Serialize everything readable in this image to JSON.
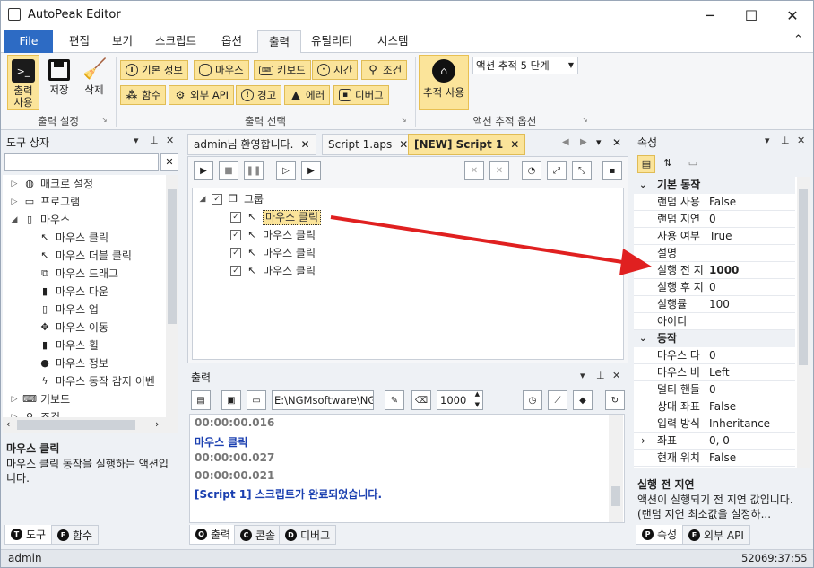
{
  "window": {
    "title": "AutoPeak Editor",
    "minimize": "─",
    "maximize": "☐",
    "close": "✕"
  },
  "menu": {
    "tabs": [
      "File",
      "편집",
      "보기",
      "스크립트",
      "옵션",
      "출력",
      "유틸리티",
      "시스템"
    ],
    "active": "출력",
    "collapse": "⌃"
  },
  "ribbon": {
    "output_settings": {
      "group_label": "출력 설정",
      "buttons": [
        {
          "label": "출력\n사용",
          "l1": "출력",
          "l2": "사용"
        },
        {
          "label": "저장"
        },
        {
          "label": "삭제"
        }
      ]
    },
    "output_select": {
      "group_label": "출력 선택",
      "row1": [
        "기본 정보",
        "마우스",
        "키보드",
        "시간",
        "조건"
      ],
      "row2": [
        "함수",
        "외부 API",
        "경고",
        "에러",
        "디버그"
      ]
    },
    "action_trace": {
      "group_label": "액션 추적 옵션",
      "button": "추적 사용",
      "select_value": "액션 추적 5 단계"
    }
  },
  "toolbox": {
    "title": "도구 상자",
    "search_placeholder": "",
    "items": [
      {
        "label": "매크로 설정",
        "level": 0,
        "expand": "▷",
        "icon": "globe-icon",
        "glyph": "◍"
      },
      {
        "label": "프로그램",
        "level": 0,
        "expand": "▷",
        "icon": "program-icon",
        "glyph": "▭"
      },
      {
        "label": "마우스",
        "level": 0,
        "expand": "◢",
        "icon": "mouse-icon",
        "glyph": "▯"
      },
      {
        "label": "마우스 클릭",
        "level": 1,
        "icon": "mouse-click-icon",
        "glyph": "↖"
      },
      {
        "label": "마우스 더블 클릭",
        "level": 1,
        "icon": "mouse-double-click-icon",
        "glyph": "↖"
      },
      {
        "label": "마우스 드래그",
        "level": 1,
        "icon": "mouse-drag-icon",
        "glyph": "⧉"
      },
      {
        "label": "마우스 다운",
        "level": 1,
        "icon": "mouse-down-icon",
        "glyph": "▮"
      },
      {
        "label": "마우스 업",
        "level": 1,
        "icon": "mouse-up-icon",
        "glyph": "▯"
      },
      {
        "label": "마우스 이동",
        "level": 1,
        "icon": "mouse-move-icon",
        "glyph": "✥"
      },
      {
        "label": "마우스 휠",
        "level": 1,
        "icon": "mouse-wheel-icon",
        "glyph": "▮"
      },
      {
        "label": "마우스 정보",
        "level": 1,
        "icon": "mouse-info-icon",
        "glyph": "●"
      },
      {
        "label": "마우스 동작 감지 이벤",
        "level": 1,
        "icon": "lightning-icon",
        "glyph": "ϟ"
      },
      {
        "label": "키보드",
        "level": 0,
        "expand": "▷",
        "icon": "keyboard-icon",
        "glyph": "⌨"
      },
      {
        "label": "조건",
        "level": 0,
        "expand": "▷",
        "icon": "condition-icon",
        "glyph": "⚲"
      }
    ],
    "desc_title": "마우스 클릭",
    "desc_body": "마우스 클릭 동작을 실행하는 액션입니다.",
    "bottom_tabs": [
      {
        "letter": "T",
        "label": "도구"
      },
      {
        "letter": "F",
        "label": "함수"
      }
    ]
  },
  "document": {
    "tabs": [
      {
        "label": "admin님 환영합니다.",
        "close": "✕"
      },
      {
        "label": "Script 1.aps",
        "close": "✕"
      },
      {
        "label": "[NEW] Script 1",
        "close": "✕"
      }
    ],
    "tree": {
      "root": "그룹",
      "items": [
        "마우스 클릭",
        "마우스 클릭",
        "마우스 클릭",
        "마우스 클릭"
      ]
    }
  },
  "output": {
    "title": "출력",
    "path_value": "E:\\NGMsoftware\\NG",
    "count_value": "1000",
    "lines": [
      {
        "text": "00:00:00.016",
        "kind": "time"
      },
      {
        "text": "마우스 클릭",
        "kind": "msg"
      },
      {
        "text": "00:00:00.027",
        "kind": "time"
      },
      {
        "text": "00:00:00.021",
        "kind": "time"
      },
      {
        "text": "[Script 1] 스크립트가 완료되었습니다.",
        "kind": "msg"
      }
    ],
    "bottom_tabs": [
      {
        "letter": "O",
        "label": "출력"
      },
      {
        "letter": "C",
        "label": "콘솔"
      },
      {
        "letter": "D",
        "label": "디버그"
      }
    ]
  },
  "properties": {
    "title": "속성",
    "categories": [
      {
        "name": "기본 동작",
        "rows": [
          {
            "name": "랜덤 사용",
            "value": "False"
          },
          {
            "name": "랜덤 지연",
            "value": "0"
          },
          {
            "name": "사용 여부",
            "value": "True"
          },
          {
            "name": "설명",
            "value": ""
          },
          {
            "name": "실행 전 지",
            "value": "1000",
            "bold": true
          },
          {
            "name": "실행 후 지",
            "value": "0"
          },
          {
            "name": "실행률",
            "value": "100"
          },
          {
            "name": "아이디",
            "value": ""
          }
        ]
      },
      {
        "name": "동작",
        "rows": [
          {
            "name": "마우스 다",
            "value": "0"
          },
          {
            "name": "마우스 버",
            "value": "Left"
          },
          {
            "name": "멀티 핸들",
            "value": "0"
          },
          {
            "name": "상대 좌표",
            "value": "False"
          },
          {
            "name": "입력 방식",
            "value": "Inheritance"
          },
          {
            "name": "좌표",
            "value": "0, 0",
            "expand": "›"
          },
          {
            "name": "현재 위치",
            "value": "False"
          }
        ]
      }
    ],
    "desc_title": "실행 전 지연",
    "desc_body": "액션이 실행되기 전 지연 값입니다. (랜덤 지연 최소값을 설정하...",
    "bottom_tabs": [
      {
        "letter": "P",
        "label": "속성"
      },
      {
        "letter": "E",
        "label": "외부 API"
      }
    ]
  },
  "status": {
    "user": "admin",
    "time": "52069:37:55"
  },
  "colors": {
    "accent": "#2d6bc4",
    "highlight": "#fbe49a",
    "arrow": "#e02020",
    "output_msg": "#1a3fb0",
    "output_time": "#777777"
  }
}
